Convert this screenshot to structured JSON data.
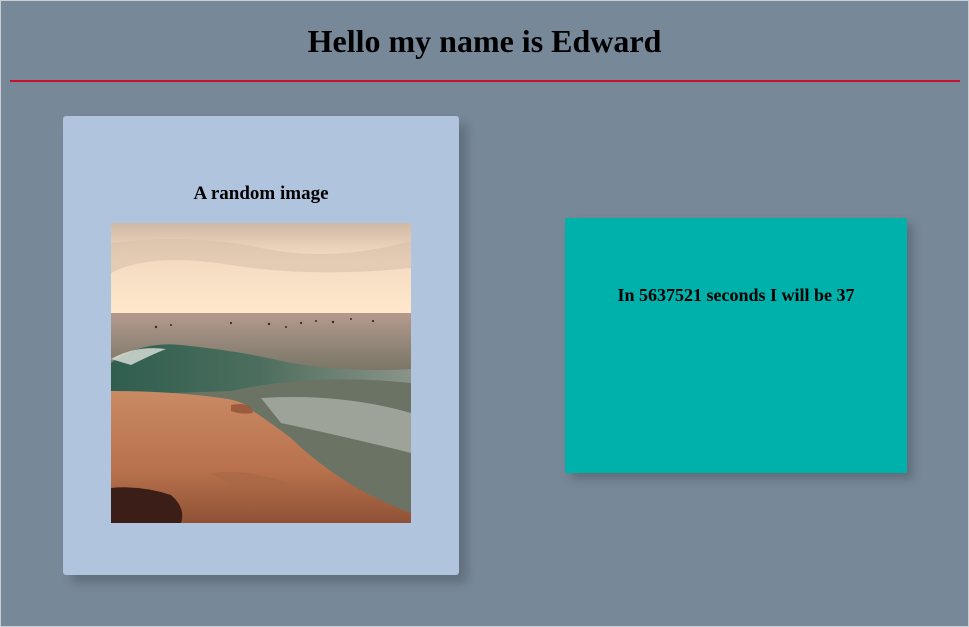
{
  "header": {
    "title": "Hello my name is Edward"
  },
  "image_card": {
    "heading": "A random image",
    "image_subject": "ocean-waves-on-sandy-shore-at-sunset"
  },
  "age_card": {
    "text": "In 5637521 seconds I will be 37"
  },
  "colors": {
    "page_background": "#778899",
    "divider": "#c8102e",
    "image_card_background": "#b0c4de",
    "age_card_background": "#00b0aa"
  }
}
